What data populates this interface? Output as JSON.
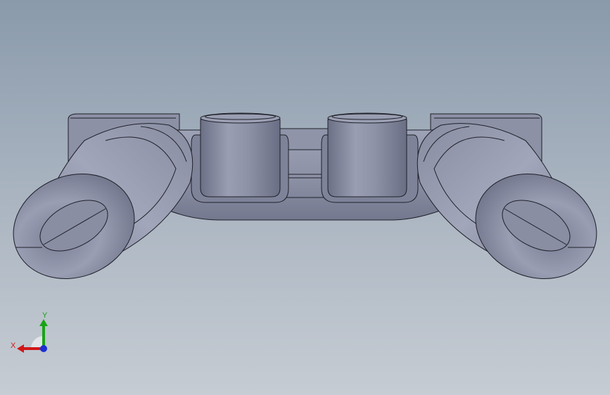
{
  "colors": {
    "background_top": "#8a9aab",
    "background_bottom": "#c6ccd3",
    "part_light": "#a3a7bb",
    "part_mid": "#8a8ea3",
    "part_dark": "#6c7086",
    "edge": "#1e2028",
    "x_axis": "#d11717",
    "y_axis": "#19a319",
    "z_axis": "#1a2fd6"
  },
  "triad": {
    "x_label": "X",
    "y_label": "Y"
  }
}
